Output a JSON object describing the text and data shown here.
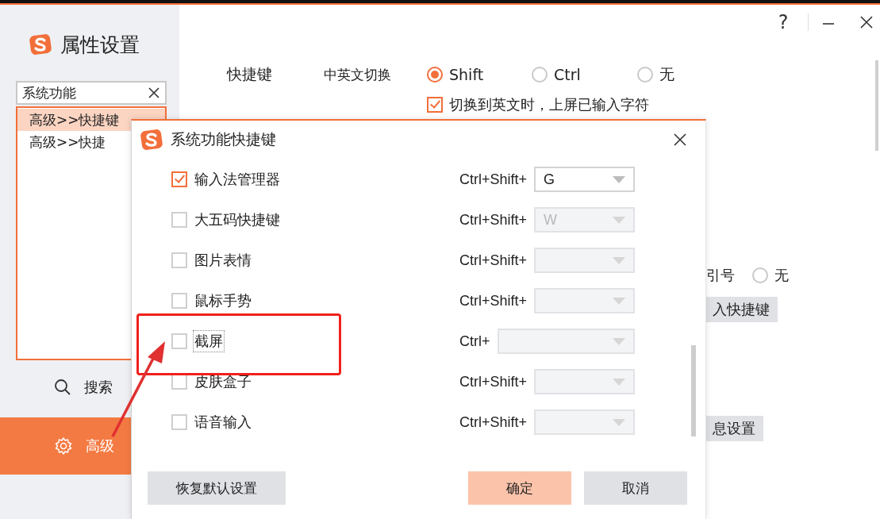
{
  "window": {
    "title": "属性设置",
    "help": "?"
  },
  "sidebar": {
    "search": {
      "value": "系统功能"
    },
    "results": [
      {
        "label": "高级>>快捷键",
        "selected": true
      },
      {
        "label": "高级>>快捷",
        "selected": false
      }
    ],
    "nav": [
      {
        "label": "搜索",
        "selected": false
      },
      {
        "label": "高级",
        "selected": true
      }
    ]
  },
  "shortcuts": {
    "label": "快捷键",
    "toggle_label": "中英文切换",
    "options": [
      {
        "label": "Shift",
        "selected": true
      },
      {
        "label": "Ctrl",
        "selected": false
      },
      {
        "label": "无",
        "selected": false
      }
    ],
    "commit_option": {
      "label": "切换到英文时，上屏已输入字符",
      "checked": true
    }
  },
  "partial": {
    "quote_label": "引号",
    "quote_option": {
      "label": "无",
      "selected": false
    },
    "buttons": [
      "入快捷键",
      "息设置"
    ]
  },
  "dialog": {
    "title": "系统功能快捷键",
    "rows": [
      {
        "label": "输入法管理器",
        "checked": true,
        "focused": false,
        "modifier": "Ctrl+Shift+",
        "key": "G",
        "disabled": false
      },
      {
        "label": "大五码快捷键",
        "checked": false,
        "focused": false,
        "modifier": "Ctrl+Shift+",
        "key": "W",
        "disabled": true
      },
      {
        "label": "图片表情",
        "checked": false,
        "focused": false,
        "modifier": "Ctrl+Shift+",
        "disabled": true
      },
      {
        "label": "鼠标手势",
        "checked": false,
        "focused": false,
        "modifier": "Ctrl+Shift+",
        "disabled": true
      },
      {
        "label": "截屏",
        "checked": false,
        "focused": true,
        "modifier": "Ctrl+",
        "disabled": true
      },
      {
        "label": "皮肤盒子",
        "checked": false,
        "focused": false,
        "modifier": "Ctrl+Shift+",
        "disabled": true
      },
      {
        "label": "语音输入",
        "checked": false,
        "focused": false,
        "modifier": "Ctrl+Shift+",
        "disabled": true
      }
    ],
    "buttons": [
      {
        "label": "恢复默认设置",
        "kind": "default"
      },
      {
        "label": "确定",
        "kind": "primary"
      },
      {
        "label": "取消",
        "kind": "secondary"
      }
    ]
  }
}
